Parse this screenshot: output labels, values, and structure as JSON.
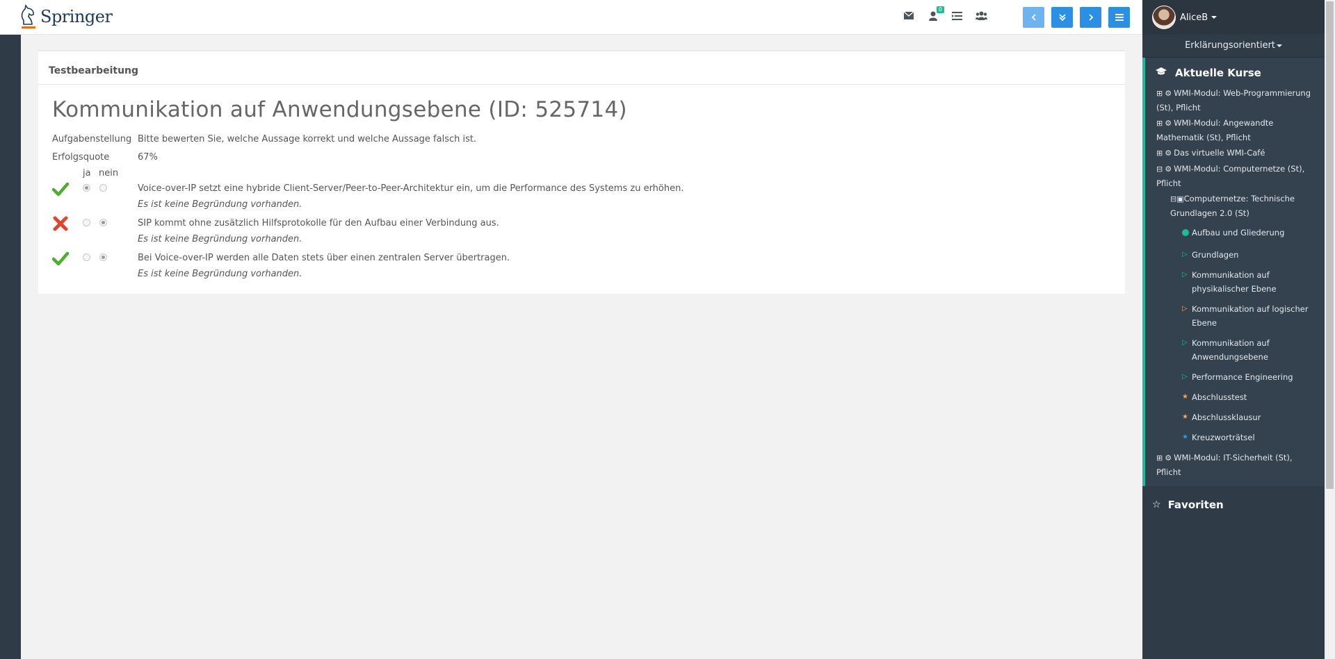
{
  "header": {
    "logo_text": "Springer",
    "notification_count": "0",
    "icons": [
      "envelope-icon",
      "user-notify-icon",
      "list-icon",
      "users-icon"
    ],
    "nav_buttons": [
      "chevron-left-icon",
      "double-chevron-down-icon",
      "chevron-right-icon",
      "hamburger-icon"
    ]
  },
  "user": {
    "name": "AliceB"
  },
  "mode": {
    "label": "Erklärungsorientiert"
  },
  "sidebar": {
    "courses_title": "Aktuelle Kurse",
    "favorites_title": "Favoriten",
    "courses": [
      {
        "expander": "⊞",
        "label": "WMI-Modul: Web-Programmierung (St), Pflicht"
      },
      {
        "expander": "⊞",
        "label": "WMI-Modul: Angewandte Mathematik (St), Pflicht"
      },
      {
        "expander": "⊞",
        "label": "Das virtuelle WMI-Café"
      },
      {
        "expander": "⊟",
        "label": "WMI-Modul: Computernetze (St), Pflicht"
      }
    ],
    "subcourse": {
      "expander": "⊟",
      "label": "Computernetze: Technische Grundlagen 2.0 (St)"
    },
    "leaves": [
      {
        "marker": "dot",
        "label": "Aufbau und Gliederung"
      },
      {
        "marker": "triangle-green",
        "label": "Grundlagen"
      },
      {
        "marker": "triangle-green",
        "label": "Kommunikation auf physikalischer Ebene"
      },
      {
        "marker": "triangle-orange",
        "label": "Kommunikation auf logischer Ebene"
      },
      {
        "marker": "triangle-green",
        "label": "Kommunikation auf Anwendungsebene"
      },
      {
        "marker": "triangle-green",
        "label": "Performance Engineering"
      },
      {
        "marker": "star-orange",
        "label": "Abschlusstest"
      },
      {
        "marker": "star-orange",
        "label": "Abschlussklausur"
      },
      {
        "marker": "star-blue",
        "label": "Kreuzworträtsel"
      }
    ],
    "last_course": {
      "expander": "⊞",
      "label": "WMI-Modul: IT-Sicherheit (St), Pflicht"
    }
  },
  "main": {
    "card_header": "Testbearbeitung",
    "title": "Kommunikation auf Anwendungsebene (ID: 525714)",
    "task_label": "Aufgabenstellung",
    "task_text": "Bitte bewerten Sie, welche Aussage korrekt und welche Aussage falsch ist.",
    "rate_label": "Erfolgsquote",
    "rate_value": "67%",
    "col_yes": "ja",
    "col_no": "nein",
    "answers": [
      {
        "result": "correct",
        "selected": "ja",
        "text": "Voice-over-IP setzt eine hybride Client-Server/Peer-to-Peer-Architektur ein, um die Performance des Systems zu erhöhen.",
        "reason": "Es ist keine Begründung vorhanden."
      },
      {
        "result": "wrong",
        "selected": "nein",
        "text": "SIP kommt ohne zusätzlich Hilfsprotokolle für den Aufbau einer Verbindung aus.",
        "reason": "Es ist keine Begründung vorhanden."
      },
      {
        "result": "correct",
        "selected": "nein",
        "text": "Bei Voice-over-IP werden alle Daten stets über einen zentralen Server übertragen.",
        "reason": "Es ist keine Begründung vorhanden."
      }
    ]
  },
  "colors": {
    "accent": "#1abc9c",
    "primary_button": "#2b8fe4",
    "sidebar_bg": "#2f3b47",
    "correct": "#4caf2a",
    "wrong": "#e0452d"
  }
}
